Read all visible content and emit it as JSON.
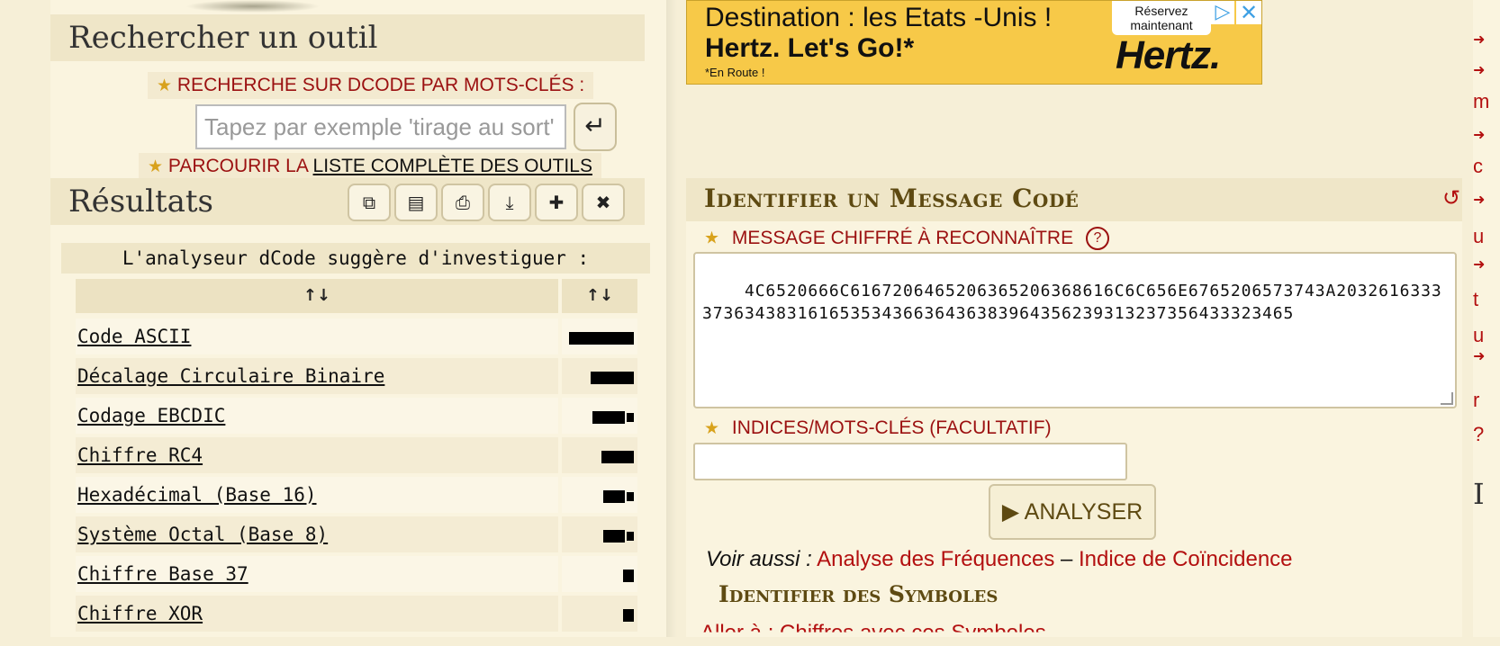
{
  "left": {
    "search_title": "Rechercher un outil",
    "keyword_label": "RECHERCHE SUR DCODE PAR MOTS-CLÉS :",
    "search_placeholder": "Tapez par exemple 'tirage au sort'",
    "browse_prefix": "PARCOURIR LA ",
    "browse_link": "LISTE COMPLÈTE DES OUTILS",
    "results_title": "Résultats",
    "toolbar_icons": [
      "copy-icon",
      "save-icon",
      "print-icon",
      "download-icon",
      "pin-icon",
      "close-icon"
    ],
    "analyzer_note": "L'analyseur dCode suggère d'investiguer :",
    "table_headers": [
      "↑↓",
      "↑↓"
    ],
    "results": [
      {
        "name": "Code ASCII",
        "score": 6
      },
      {
        "name": "Décalage Circulaire Binaire",
        "score": 4
      },
      {
        "name": "Codage EBCDIC",
        "score": 3.5
      },
      {
        "name": "Chiffre RC4",
        "score": 3
      },
      {
        "name": "Hexadécimal (Base 16)",
        "score": 2.5
      },
      {
        "name": "Système Octal (Base 8)",
        "score": 2.5
      },
      {
        "name": "Chiffre Base 37",
        "score": 1
      },
      {
        "name": "Chiffre XOR",
        "score": 1
      }
    ]
  },
  "ad": {
    "line1": "Destination : les Etats -Unis !",
    "line2": "Hertz. Let's Go!*",
    "line3": "*En Route !",
    "reserve": "Réservez maintenant",
    "logo": "Hertz."
  },
  "panel": {
    "title": "Identifier un Message Codé",
    "message_label": "MESSAGE CHIFFRÉ À RECONNAÎTRE",
    "message_value": "4C6520666C6167206465206365206368616C6C656E6765206573743A203261633337363438316165353436636436383964356239313237356433323465",
    "hints_label": "INDICES/MOTS-CLÉS (FACULTATIF)",
    "hints_value": "",
    "analyze_label": "ANALYSER",
    "see_also_lead": "Voir aussi :",
    "see_also_link1": "Analyse des Fréquences",
    "see_also_sep": " – ",
    "see_also_link2": "Indice de Coïncidence",
    "identify_symbols": "Identifier des Symboles",
    "partial_next": "Aller à : Chiffres avec ces Symboles"
  },
  "sidebar": {
    "letters": [
      "m",
      "c",
      "u",
      "t",
      "u",
      "r",
      "?",
      "I"
    ]
  },
  "colors": {
    "background": "#f6efd7",
    "accent_red": "#9b1010",
    "title_brown": "#5e4a12",
    "ad_yellow": "#f7c948",
    "star_gold": "#d8a21c"
  }
}
